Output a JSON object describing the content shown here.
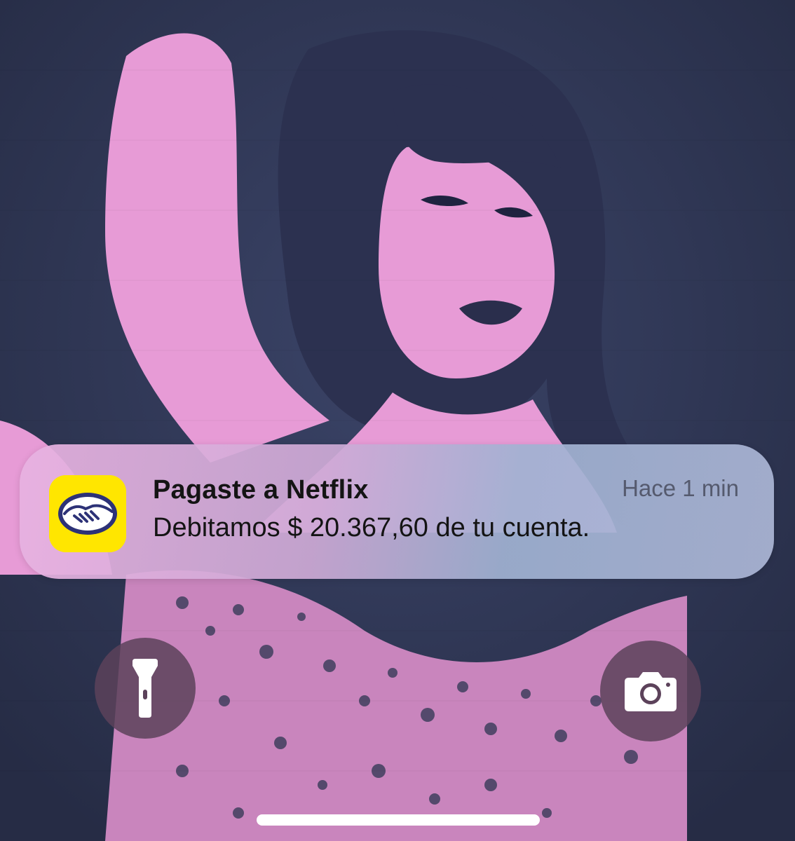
{
  "notification": {
    "app_icon": "mercado-pago-handshake-icon",
    "title": "Pagaste a Netflix",
    "time": "Hace 1 min",
    "body": "Debitamos $ 20.367,60 de tu cuenta."
  },
  "quick_actions": {
    "left_icon": "flashlight-icon",
    "right_icon": "camera-icon"
  },
  "colors": {
    "app_icon_yellow": "#ffe600",
    "handshake_blue": "#2d3277",
    "wallpaper_pink": "#e79bd6",
    "wallpaper_navy": "#2e3552"
  }
}
